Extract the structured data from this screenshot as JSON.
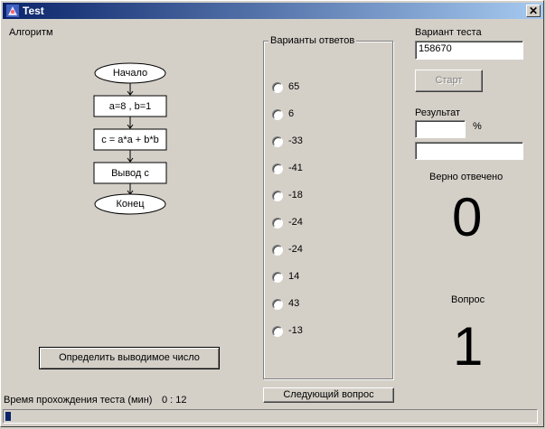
{
  "window": {
    "title": "Test"
  },
  "algorithm": {
    "label": "Алгоритм",
    "steps": {
      "start": "Начало",
      "assign": "a=8 , b=1",
      "compute": "c = a*a + b*b",
      "output": "Вывод c",
      "end": "Конец"
    },
    "button_label": "Определить выводимое число"
  },
  "answers": {
    "legend": "Варианты ответов",
    "options": [
      "65",
      "6",
      "-33",
      "-41",
      "-18",
      "-24",
      "-24",
      "14",
      "43",
      "-13"
    ],
    "next_button": "Следующий вопрос"
  },
  "right_panel": {
    "variant_label": "Вариант теста",
    "variant_value": "158670",
    "start_button": "Старт",
    "result_label": "Результат",
    "percent_sign": "%",
    "result_value": "",
    "result_text": "",
    "correct_label": "Верно отвечено",
    "correct_count": "0",
    "question_label": "Вопрос",
    "question_number": "1"
  },
  "status": {
    "time_label": "Время прохождения теста (мин)",
    "time_value": "0 : 12",
    "progress": 0.01
  }
}
